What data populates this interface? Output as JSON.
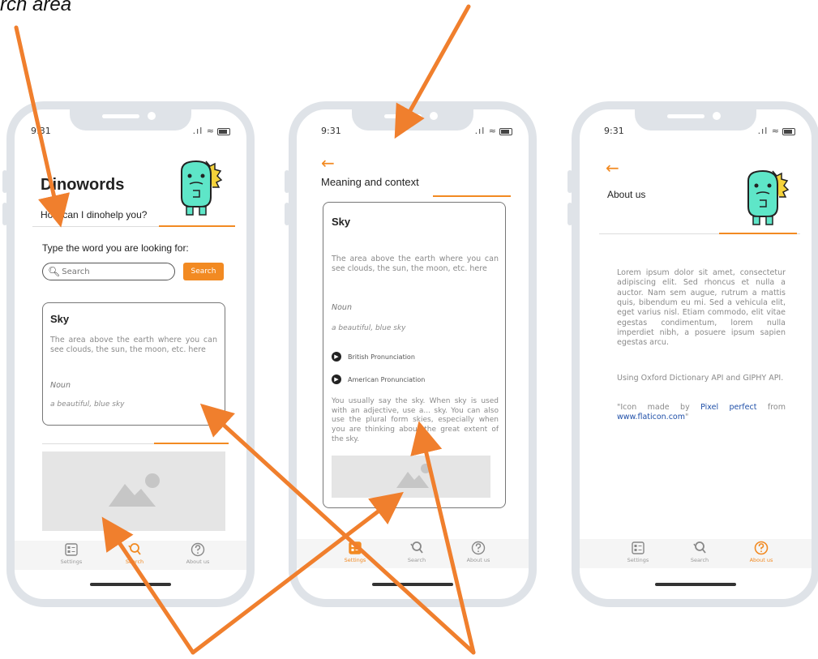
{
  "caption": "rch area",
  "status": {
    "time": "9:31"
  },
  "brand": {
    "primary": "#f28a22",
    "link": "#1f4fa8",
    "dino": "#5ee6c8"
  },
  "screen1": {
    "title": "Dinowords",
    "subtitle": "How can I dinohelp you?",
    "prompt": "Type the word you are looking for:",
    "search_placeholder": "Search",
    "search_button": "Search",
    "word": "Sky",
    "definition": "The area above the earth where you can see clouds, the sun, the moon, etc. here",
    "part_of_speech": "Noun",
    "example": "a beautiful, blue sky"
  },
  "screen2": {
    "title": "Meaning and context",
    "word": "Sky",
    "definition": "The area above the earth where you can see clouds, the sun, the moon, etc. here",
    "part_of_speech": "Noun",
    "example": "a beautiful, blue sky",
    "pron_british": "British Pronunciation",
    "pron_american": "American Pronunciation",
    "context": "You usually say the sky. When sky is used with an adjective, use a... sky. You can also use the plural form skies, especially when you are thinking about the great extent of the sky."
  },
  "screen3": {
    "title": "About us",
    "lorem": "Lorem ipsum dolor sit amet, consectetur adipiscing elit. Sed rhoncus et nulla a auctor. Nam sem augue, rutrum a mattis quis, bibendum eu mi. Sed a vehicula elit, eget varius nisl. Etiam commodo, elit vitae egestas condimentum, lorem nulla imperdiet nibh, a posuere ipsum sapien egestas arcu.",
    "apis": "Using Oxford Dictionary API and GIPHY API.",
    "credit_prefix": "\"Icon made by ",
    "credit_author": "Pixel perfect",
    "credit_mid": " from ",
    "credit_site": "www.flaticon.com",
    "credit_suffix": "\""
  },
  "tabs": {
    "settings": "Settings",
    "search": "Search",
    "about": "About us"
  }
}
